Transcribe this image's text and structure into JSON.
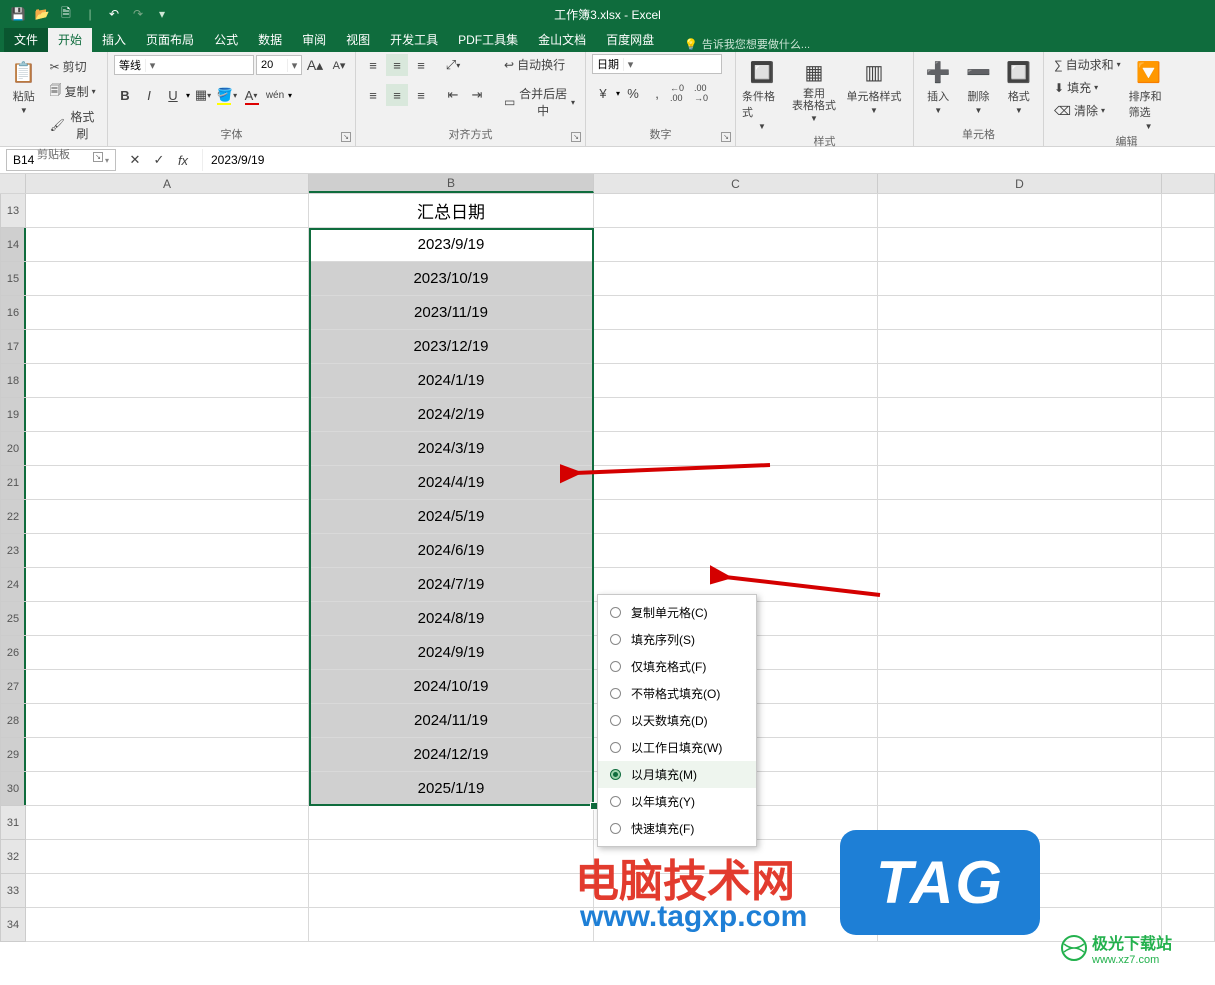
{
  "title": "工作簿3.xlsx - Excel",
  "qat": {
    "save": "💾",
    "open": "📂",
    "new": "🗎",
    "undo": "↶",
    "redo": "↷"
  },
  "tabs": {
    "file": "文件",
    "home": "开始",
    "insert": "插入",
    "layout": "页面布局",
    "formulas": "公式",
    "data": "数据",
    "review": "审阅",
    "view": "视图",
    "dev": "开发工具",
    "pdf": "PDF工具集",
    "wps": "金山文档",
    "baidu": "百度网盘",
    "tellme": "告诉我您想要做什么..."
  },
  "ribbon": {
    "clipboard": {
      "paste": "粘贴",
      "cut": "剪切",
      "copy": "复制",
      "painter": "格式刷",
      "label": "剪贴板"
    },
    "font": {
      "family": "等线",
      "size": "20",
      "bold": "B",
      "italic": "I",
      "underline": "U",
      "label": "字体",
      "wen": "wén"
    },
    "align": {
      "wrap": "自动换行",
      "merge": "合并后居中",
      "label": "对齐方式"
    },
    "number": {
      "format": "日期",
      "label": "数字",
      "curr": "¥",
      "pct": "%",
      "comma": ",",
      "inc": "←0 .00",
      "dec": ".00 →0"
    },
    "styles": {
      "cond": "条件格式",
      "table": "套用\n表格格式",
      "cellstyle": "单元格样式",
      "label": "样式"
    },
    "cells": {
      "insert": "插入",
      "delete": "删除",
      "format": "格式",
      "label": "单元格"
    },
    "editing": {
      "sum": "自动求和",
      "fill": "填充",
      "clear": "清除",
      "sort": "排序和筛选",
      "label": "编辑"
    }
  },
  "nameBox": "B14",
  "formula": "2023/9/19",
  "colHeaders": [
    "A",
    "B",
    "C",
    "D"
  ],
  "rowNumbers": [
    13,
    14,
    15,
    16,
    17,
    18,
    19,
    20,
    21,
    22,
    23,
    24,
    25,
    26,
    27,
    28,
    29,
    30,
    31,
    32,
    33,
    34
  ],
  "headerCell": "汇总日期",
  "dates": [
    "2023/9/19",
    "2023/10/19",
    "2023/11/19",
    "2023/12/19",
    "2024/1/19",
    "2024/2/19",
    "2024/3/19",
    "2024/4/19",
    "2024/5/19",
    "2024/6/19",
    "2024/7/19",
    "2024/8/19",
    "2024/9/19",
    "2024/10/19",
    "2024/11/19",
    "2024/12/19",
    "2025/1/19"
  ],
  "contextMenu": {
    "copyCells": "复制单元格(C)",
    "fillSeries": "填充序列(S)",
    "fillFmt": "仅填充格式(F)",
    "noFmt": "不带格式填充(O)",
    "days": "以天数填充(D)",
    "weekdays": "以工作日填充(W)",
    "months": "以月填充(M)",
    "years": "以年填充(Y)",
    "flash": "快速填充(F)"
  },
  "watermark": {
    "line1": "电脑技术网",
    "line2": "www.tagxp.com",
    "tag": "TAG",
    "jg": "极光下载站",
    "jgurl": "www.xz7.com"
  }
}
